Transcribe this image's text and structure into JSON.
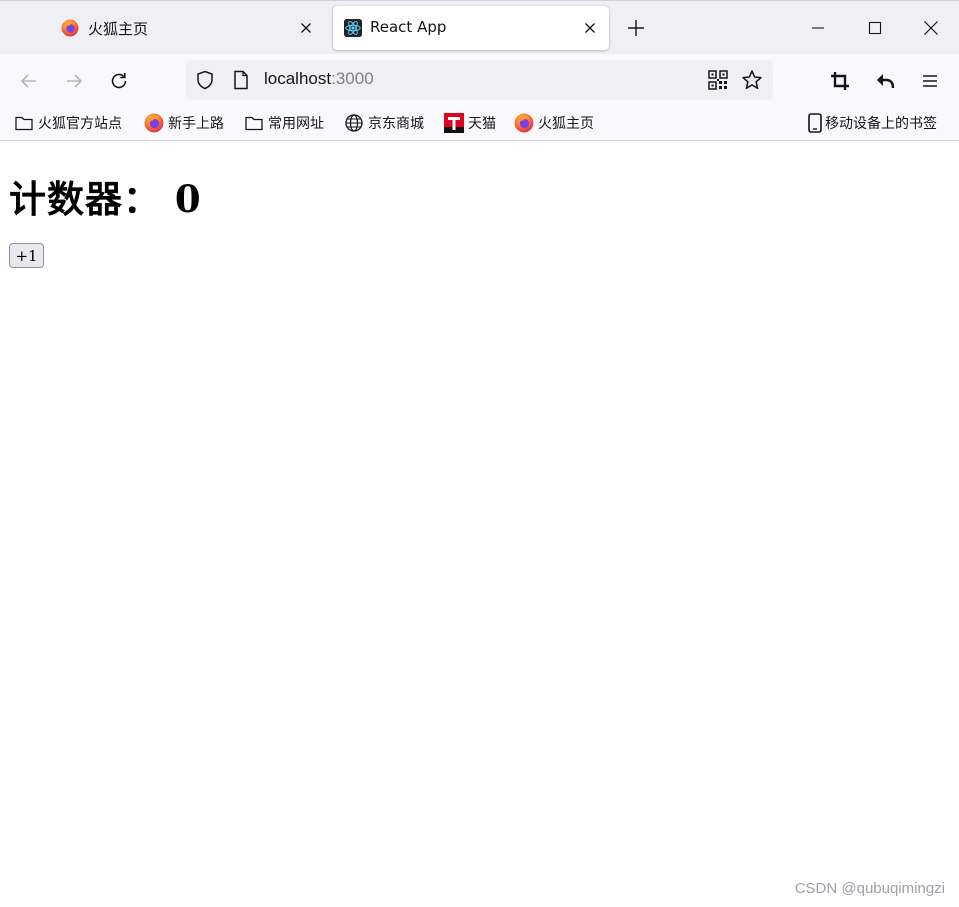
{
  "browser": {
    "tabs": [
      {
        "title": "火狐主页",
        "favicon": "firefox-icon",
        "active": false
      },
      {
        "title": "React App",
        "favicon": "react-icon",
        "active": true
      }
    ],
    "url": {
      "host": "localhost",
      "port": ":3000"
    },
    "bookmarks": [
      {
        "label": "火狐官方站点",
        "icon": "folder-icon"
      },
      {
        "label": "新手上路",
        "icon": "firefox-icon"
      },
      {
        "label": "常用网址",
        "icon": "folder-icon"
      },
      {
        "label": "京东商城",
        "icon": "globe-icon"
      },
      {
        "label": "天猫",
        "icon": "tmall-icon"
      },
      {
        "label": "火狐主页",
        "icon": "firefox-icon"
      }
    ],
    "mobile_bookmarks": {
      "label": "移动设备上的书签",
      "icon": "mobile-device-icon"
    }
  },
  "page": {
    "heading": "计数器： 0",
    "increment_label": "+1"
  },
  "watermark": "CSDN @qubuqimingzi",
  "colors": {
    "tab_strip": "#f0f0f4",
    "toolbar": "#f9f9fb",
    "button_bg": "#e9e9ed"
  }
}
